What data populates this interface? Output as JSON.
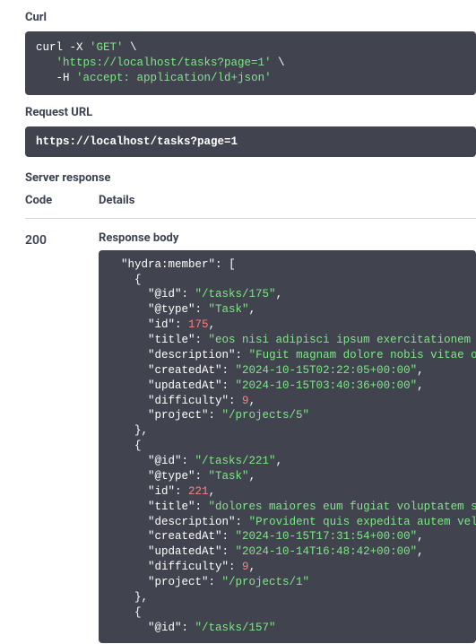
{
  "labels": {
    "curl": "Curl",
    "request_url": "Request URL",
    "server_response": "Server response",
    "code_header": "Code",
    "details_header": "Details",
    "response_body": "Response body"
  },
  "curl": {
    "line1_cmd": "curl -X ",
    "line1_method": "'GET'",
    "line1_cont": " \\",
    "line2_indent": "   ",
    "line2_url": "'https://localhost/tasks?page=1'",
    "line2_cont": " \\",
    "line3_indent": "   ",
    "line3_flag": "-H ",
    "line3_header": "'accept: application/ld+json'"
  },
  "request_url_value": "https://localhost/tasks?page=1",
  "response": {
    "code": "200"
  },
  "json": {
    "hydra_member_key": "\"hydra:member\"",
    "open_bracket": "[",
    "open_brace": "{",
    "close_brace": "}",
    "close_brace_comma": "},",
    "colon": ": ",
    "comma": ",",
    "k_id": "\"@id\"",
    "k_type": "\"@type\"",
    "k_numid": "\"id\"",
    "k_title": "\"title\"",
    "k_description": "\"description\"",
    "k_createdAt": "\"createdAt\"",
    "k_updatedAt": "\"updatedAt\"",
    "k_difficulty": "\"difficulty\"",
    "k_project": "\"project\"",
    "m0": {
      "id": "\"/tasks/175\"",
      "type": "\"Task\"",
      "numid": "175",
      "title": "\"eos nisi adipisci ipsum exercitationem dol",
      "description": "\"Fugit magnam dolore nobis vitae offi",
      "createdAt": "\"2024-10-15T02:22:05+00:00\"",
      "updatedAt": "\"2024-10-15T03:40:36+00:00\"",
      "difficulty": "9",
      "project": "\"/projects/5\""
    },
    "m1": {
      "id": "\"/tasks/221\"",
      "type": "\"Task\"",
      "numid": "221",
      "title": "\"dolores maiores eum fugiat voluptatem sed",
      "description": "\"Provident quis expedita autem vel. S",
      "createdAt": "\"2024-10-15T17:31:54+00:00\"",
      "updatedAt": "\"2024-10-14T16:48:42+00:00\"",
      "difficulty": "9",
      "project": "\"/projects/1\""
    },
    "m2": {
      "id_partial": "\"/tasks/157\""
    }
  }
}
